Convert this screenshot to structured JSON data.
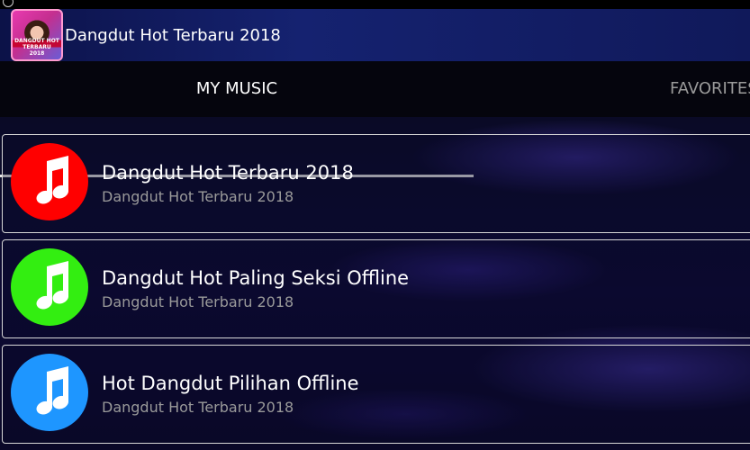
{
  "app": {
    "title": "Dangdut Hot Terbaru 2018",
    "logo_text": "DANGDUT HOT TERBARU 2018"
  },
  "tabs": [
    {
      "label": "MY MUSIC",
      "selected": true
    },
    {
      "label": "FAVORITES",
      "selected": false
    }
  ],
  "playlists": [
    {
      "title": "Dangdut Hot Terbaru 2018",
      "subtitle": "Dangdut Hot Terbaru 2018",
      "icon": "music-note-icon",
      "color": "#ff0000"
    },
    {
      "title": "Dangdut Hot Paling Seksi Offline",
      "subtitle": "Dangdut Hot Terbaru 2018",
      "icon": "music-note-icon",
      "color": "#33ee11"
    },
    {
      "title": "Hot Dangdut Pilihan Offline",
      "subtitle": "Dangdut Hot Terbaru 2018",
      "icon": "music-note-icon",
      "color": "#1e96ff"
    }
  ]
}
